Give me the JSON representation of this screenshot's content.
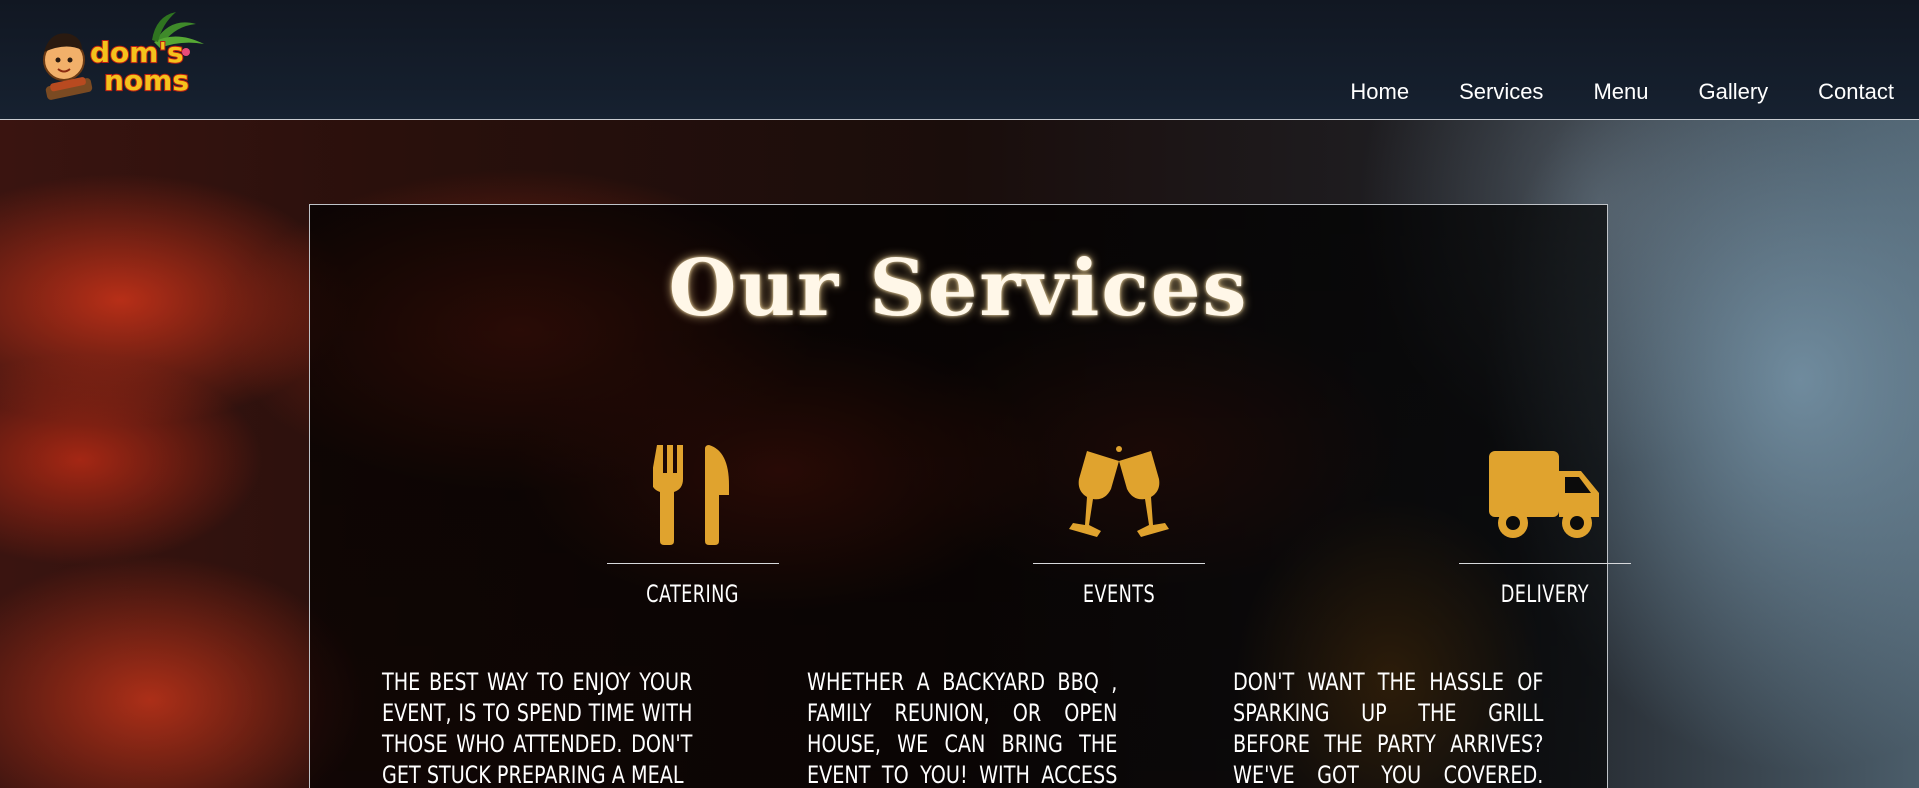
{
  "header": {
    "logo_text_line1": "dom's",
    "logo_text_line2": "noms",
    "nav": [
      {
        "label": "Home"
      },
      {
        "label": "Services"
      },
      {
        "label": "Menu"
      },
      {
        "label": "Gallery"
      },
      {
        "label": "Contact"
      }
    ]
  },
  "services": {
    "title": "Our Services",
    "accent_color": "#e0a32e",
    "items": [
      {
        "icon": "fork-knife-icon",
        "heading": "CATERING",
        "text": "The best way to enjoy your event, is to spend time with those who attended. Don't get stuck preparing a meal"
      },
      {
        "icon": "wine-glasses-toast-icon",
        "heading": "EVENTS",
        "text": "Whether a backyard BBQ , family reunion, or open house, we can bring the event to you! With access to tents,"
      },
      {
        "icon": "delivery-truck-icon",
        "heading": "DELIVERY",
        "text": "Don't want the hassle of sparking up the grill before the party arrives? We've got you covered. We'll drop off a"
      }
    ]
  }
}
